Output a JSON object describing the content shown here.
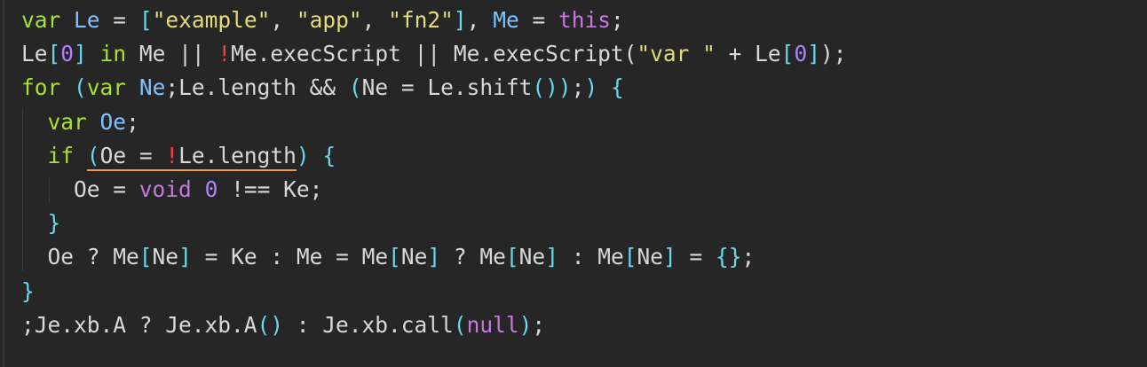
{
  "colors": {
    "background": "#262626",
    "keyword": "#a6e22e",
    "string": "#e6db74",
    "number": "#ae81ff",
    "this": "#c678dd",
    "bang": "#ff3b3b",
    "bracket": "#66d9ef",
    "warning_underline": "#f0a030"
  },
  "lines": [
    {
      "tokens": [
        {
          "t": "var",
          "k": "kw"
        },
        {
          "t": " ",
          "k": "plain"
        },
        {
          "t": "Le",
          "k": "def"
        },
        {
          "t": " = ",
          "k": "plain"
        },
        {
          "t": "[",
          "k": "brk"
        },
        {
          "t": "\"example\"",
          "k": "str"
        },
        {
          "t": ", ",
          "k": "plain"
        },
        {
          "t": "\"app\"",
          "k": "str"
        },
        {
          "t": ", ",
          "k": "plain"
        },
        {
          "t": "\"fn2\"",
          "k": "str"
        },
        {
          "t": "]",
          "k": "brk"
        },
        {
          "t": ", ",
          "k": "plain"
        },
        {
          "t": "Me",
          "k": "def"
        },
        {
          "t": " = ",
          "k": "plain"
        },
        {
          "t": "this",
          "k": "this"
        },
        {
          "t": ";",
          "k": "plain"
        }
      ]
    },
    {
      "tokens": [
        {
          "t": "Le",
          "k": "plain"
        },
        {
          "t": "[",
          "k": "brk"
        },
        {
          "t": "0",
          "k": "num"
        },
        {
          "t": "]",
          "k": "brk"
        },
        {
          "t": " ",
          "k": "plain"
        },
        {
          "t": "in",
          "k": "kw"
        },
        {
          "t": " Me || ",
          "k": "plain"
        },
        {
          "t": "!",
          "k": "bang"
        },
        {
          "t": "Me.execScript || Me.execScript(",
          "k": "plain"
        },
        {
          "t": "\"var \"",
          "k": "str"
        },
        {
          "t": " + Le",
          "k": "plain"
        },
        {
          "t": "[",
          "k": "brk"
        },
        {
          "t": "0",
          "k": "num"
        },
        {
          "t": "]",
          "k": "brk"
        },
        {
          "t": ");",
          "k": "plain"
        }
      ]
    },
    {
      "tokens": [
        {
          "t": "for",
          "k": "kw"
        },
        {
          "t": " ",
          "k": "plain"
        },
        {
          "t": "(",
          "k": "brk"
        },
        {
          "t": "var",
          "k": "kw"
        },
        {
          "t": " ",
          "k": "plain"
        },
        {
          "t": "Ne",
          "k": "def"
        },
        {
          "t": ";Le.length && ",
          "k": "plain"
        },
        {
          "t": "(",
          "k": "brk"
        },
        {
          "t": "Ne = Le.shift",
          "k": "plain"
        },
        {
          "t": "()",
          "k": "brk"
        },
        {
          "t": ")",
          "k": "brk"
        },
        {
          "t": ";",
          "k": "plain"
        },
        {
          "t": ")",
          "k": "brk"
        },
        {
          "t": " ",
          "k": "plain"
        },
        {
          "t": "{",
          "k": "brk"
        }
      ]
    },
    {
      "indent": 1,
      "tokens": [
        {
          "t": "var",
          "k": "kw"
        },
        {
          "t": " ",
          "k": "plain"
        },
        {
          "t": "Oe",
          "k": "def"
        },
        {
          "t": ";",
          "k": "plain"
        }
      ]
    },
    {
      "indent": 1,
      "tokens": [
        {
          "t": "if",
          "k": "kw"
        },
        {
          "t": " ",
          "k": "plain"
        },
        {
          "t": "(",
          "k": "brk",
          "u": true
        },
        {
          "t": "Oe = ",
          "k": "plain",
          "u": true
        },
        {
          "t": "!",
          "k": "bang",
          "u": true
        },
        {
          "t": "Le.length",
          "k": "plain",
          "u": true
        },
        {
          "t": ")",
          "k": "brk"
        },
        {
          "t": " ",
          "k": "plain"
        },
        {
          "t": "{",
          "k": "brk"
        }
      ]
    },
    {
      "indent": 2,
      "tokens": [
        {
          "t": "Oe = ",
          "k": "plain"
        },
        {
          "t": "void",
          "k": "void"
        },
        {
          "t": " ",
          "k": "plain"
        },
        {
          "t": "0",
          "k": "num"
        },
        {
          "t": " !== Ke;",
          "k": "plain"
        }
      ]
    },
    {
      "indent": 1,
      "tokens": [
        {
          "t": "}",
          "k": "brk"
        }
      ]
    },
    {
      "indent": 1,
      "tokens": [
        {
          "t": "Oe ? Me",
          "k": "plain"
        },
        {
          "t": "[",
          "k": "brk"
        },
        {
          "t": "Ne",
          "k": "plain"
        },
        {
          "t": "]",
          "k": "brk"
        },
        {
          "t": " = Ke : Me = Me",
          "k": "plain"
        },
        {
          "t": "[",
          "k": "brk"
        },
        {
          "t": "Ne",
          "k": "plain"
        },
        {
          "t": "]",
          "k": "brk"
        },
        {
          "t": " ? Me",
          "k": "plain"
        },
        {
          "t": "[",
          "k": "brk"
        },
        {
          "t": "Ne",
          "k": "plain"
        },
        {
          "t": "]",
          "k": "brk"
        },
        {
          "t": " : Me",
          "k": "plain"
        },
        {
          "t": "[",
          "k": "brk"
        },
        {
          "t": "Ne",
          "k": "plain"
        },
        {
          "t": "]",
          "k": "brk"
        },
        {
          "t": " = ",
          "k": "plain"
        },
        {
          "t": "{}",
          "k": "brk"
        },
        {
          "t": ";",
          "k": "plain"
        }
      ]
    },
    {
      "tokens": [
        {
          "t": "}",
          "k": "brk"
        }
      ]
    },
    {
      "tokens": [
        {
          "t": ";Je.xb.A ? Je.xb.A",
          "k": "plain"
        },
        {
          "t": "()",
          "k": "brk"
        },
        {
          "t": " : Je.xb.call",
          "k": "plain"
        },
        {
          "t": "(",
          "k": "brk"
        },
        {
          "t": "null",
          "k": "null"
        },
        {
          "t": ")",
          "k": "brk"
        },
        {
          "t": ";",
          "k": "plain"
        }
      ]
    }
  ]
}
